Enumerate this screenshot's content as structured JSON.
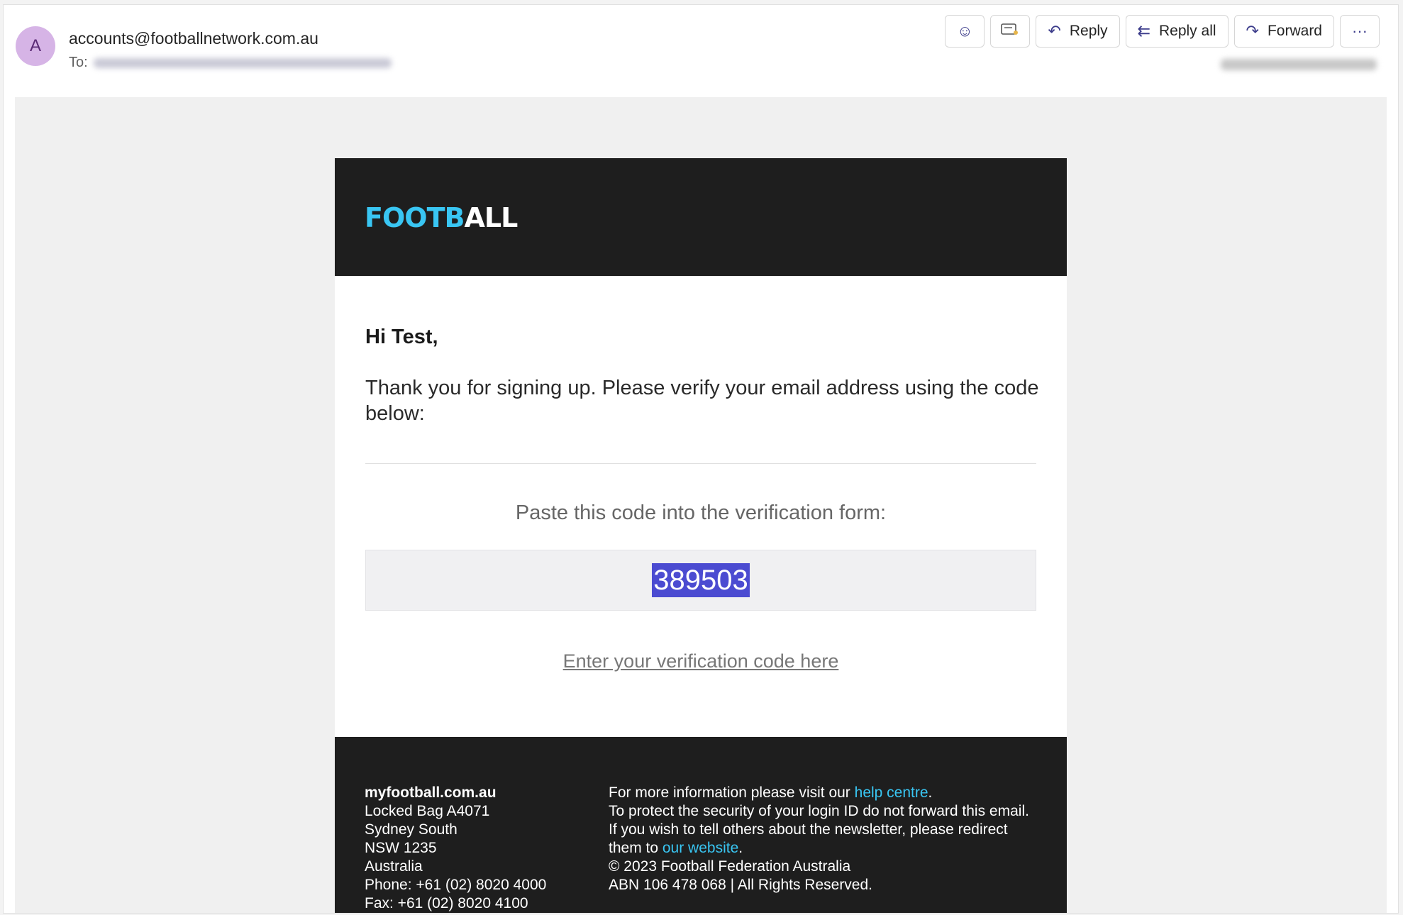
{
  "header": {
    "avatar_letter": "A",
    "sender": "accounts@footballnetwork.com.au",
    "to_label": "To:"
  },
  "toolbar": {
    "emoji_icon": "smiley-icon",
    "immersive_icon": "reader-icon",
    "reply_label": "Reply",
    "reply_all_label": "Reply all",
    "forward_label": "Forward",
    "more_label": "···"
  },
  "email": {
    "logo_part1": "FOOTB",
    "logo_part2": "ALL",
    "greeting": "Hi Test,",
    "thanks": "Thank you for signing up. Please verify your email address using the code below:",
    "paste_instruction": "Paste this code into the verification form:",
    "code": "389503",
    "enter_link": "Enter your verification code here"
  },
  "footer": {
    "site": "myfootball.com.au",
    "address1": "Locked Bag A4071",
    "address2": "Sydney South",
    "address3": "NSW 1235",
    "address4": "Australia",
    "phone": "Phone: +61 (02) 8020 4000",
    "fax": "Fax: +61 (02) 8020 4100",
    "info_pre": "For more information please visit our ",
    "info_link": "help centre",
    "info_post": ".",
    "protect_pre": "To protect the security of your login ID do not forward this email. If you wish to tell others about the newsletter, please redirect them to ",
    "protect_link": "our website",
    "protect_post": ".",
    "copyright": "© 2023 Football Federation Australia",
    "abn": "ABN 106 478 068 | All Rights Reserved."
  },
  "colors": {
    "accent": "#39c6f3",
    "dark": "#1e1e1e",
    "highlight": "#4b4bd1"
  }
}
